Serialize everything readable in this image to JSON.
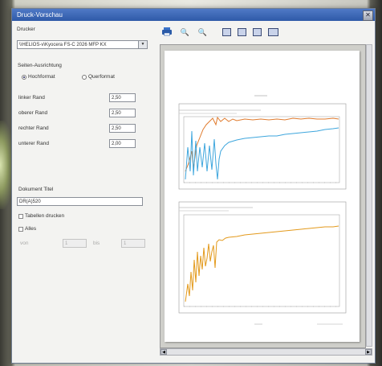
{
  "window": {
    "title": "Druck-Vorschau",
    "close_glyph": "✕"
  },
  "printer": {
    "label": "Drucker",
    "value": "\\\\HELIOS-v\\Kyocera FS-C 2026 MFP KX",
    "arrow": "▼"
  },
  "orientation": {
    "label": "Seiten-Ausrichtung",
    "portrait_label": "Hochformat",
    "landscape_label": "Querformat",
    "selected": "Hochformat"
  },
  "margins": [
    {
      "label": "linker Rand",
      "value": "2,50"
    },
    {
      "label": "oberer Rand",
      "value": "2,50"
    },
    {
      "label": "rechter Rand",
      "value": "2,50"
    },
    {
      "label": "unterer Rand",
      "value": "2,00"
    }
  ],
  "document": {
    "title_label": "Dokument Titel",
    "title_value": "DR(A)520"
  },
  "options": {
    "print_tables_label": "Tabellen drucken",
    "all_label": "Alles",
    "from_label": "von",
    "from_value": "1",
    "to_label": "bis",
    "to_value": "1"
  },
  "toolbar": {
    "icons": [
      "printer-icon",
      "zoom-in-icon",
      "zoom-out-icon",
      "single-page-icon",
      "two-page-icon",
      "three-page-icon",
      "four-page-icon"
    ],
    "zoom_glyph": "🔍"
  },
  "scroll": {
    "left": "◀",
    "right": "▶"
  },
  "colors": {
    "titlebar": "#3566b5",
    "series_orange": "#e07b2e",
    "series_blue": "#3ea6dd",
    "series_gold": "#e39a1c"
  }
}
